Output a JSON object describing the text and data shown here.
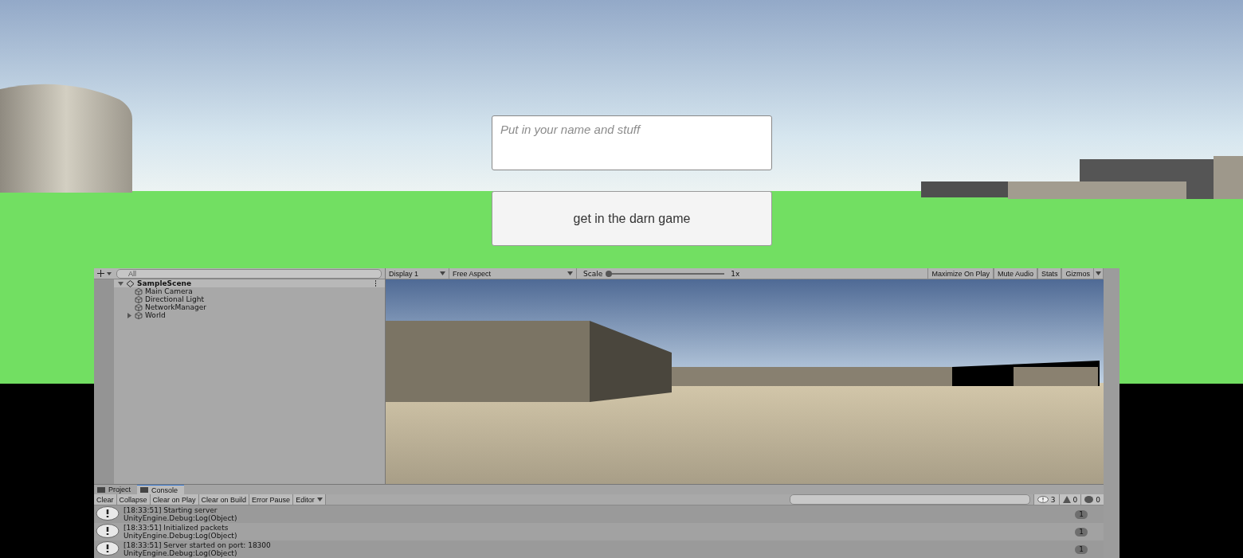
{
  "game_ui": {
    "name_field": {
      "placeholder": "Put in your name and stuff"
    },
    "join_button": "get in the darn game"
  },
  "hierarchy": {
    "search": {
      "placeholder": "All"
    },
    "scene": {
      "name": "SampleScene",
      "expanded": true,
      "children": [
        {
          "name": "Main Camera"
        },
        {
          "name": "Directional Light"
        },
        {
          "name": "NetworkManager"
        },
        {
          "name": "World",
          "expanded": false
        }
      ]
    }
  },
  "game_toolbar": {
    "display": "Display 1",
    "aspect": "Free Aspect",
    "scale_label": "Scale",
    "scale": {
      "level": 0.0
    },
    "scale_value": "1x",
    "buttons": [
      "Maximize On Play",
      "Mute Audio",
      "Stats",
      "Gizmos"
    ]
  },
  "console": {
    "tabs": [
      {
        "label": "Project",
        "selected": false
      },
      {
        "label": "Console",
        "selected": true
      }
    ],
    "toolbar": [
      {
        "kind": "button",
        "label": "Clear"
      },
      {
        "kind": "button",
        "label": "Collapse"
      },
      {
        "kind": "button",
        "label": "Clear on Play"
      },
      {
        "kind": "button",
        "label": "Clear on Build"
      },
      {
        "kind": "button",
        "label": "Error Pause"
      },
      {
        "kind": "dropdown",
        "label": "Editor"
      }
    ],
    "counts": [
      {
        "kind": "info",
        "count": "3"
      },
      {
        "kind": "warning",
        "count": "0"
      },
      {
        "kind": "error",
        "count": "0"
      }
    ],
    "entries": [
      {
        "message": "[18:33:51] Starting server",
        "source": "UnityEngine.Debug:Log(Object)",
        "count": "1"
      },
      {
        "message": "[18:33:51] Initialized packets",
        "source": "UnityEngine.Debug:Log(Object)",
        "count": "1"
      },
      {
        "message": "[18:33:51] Server started on port: 18300",
        "source": "UnityEngine.Debug:Log(Object)",
        "count": "1"
      }
    ]
  }
}
